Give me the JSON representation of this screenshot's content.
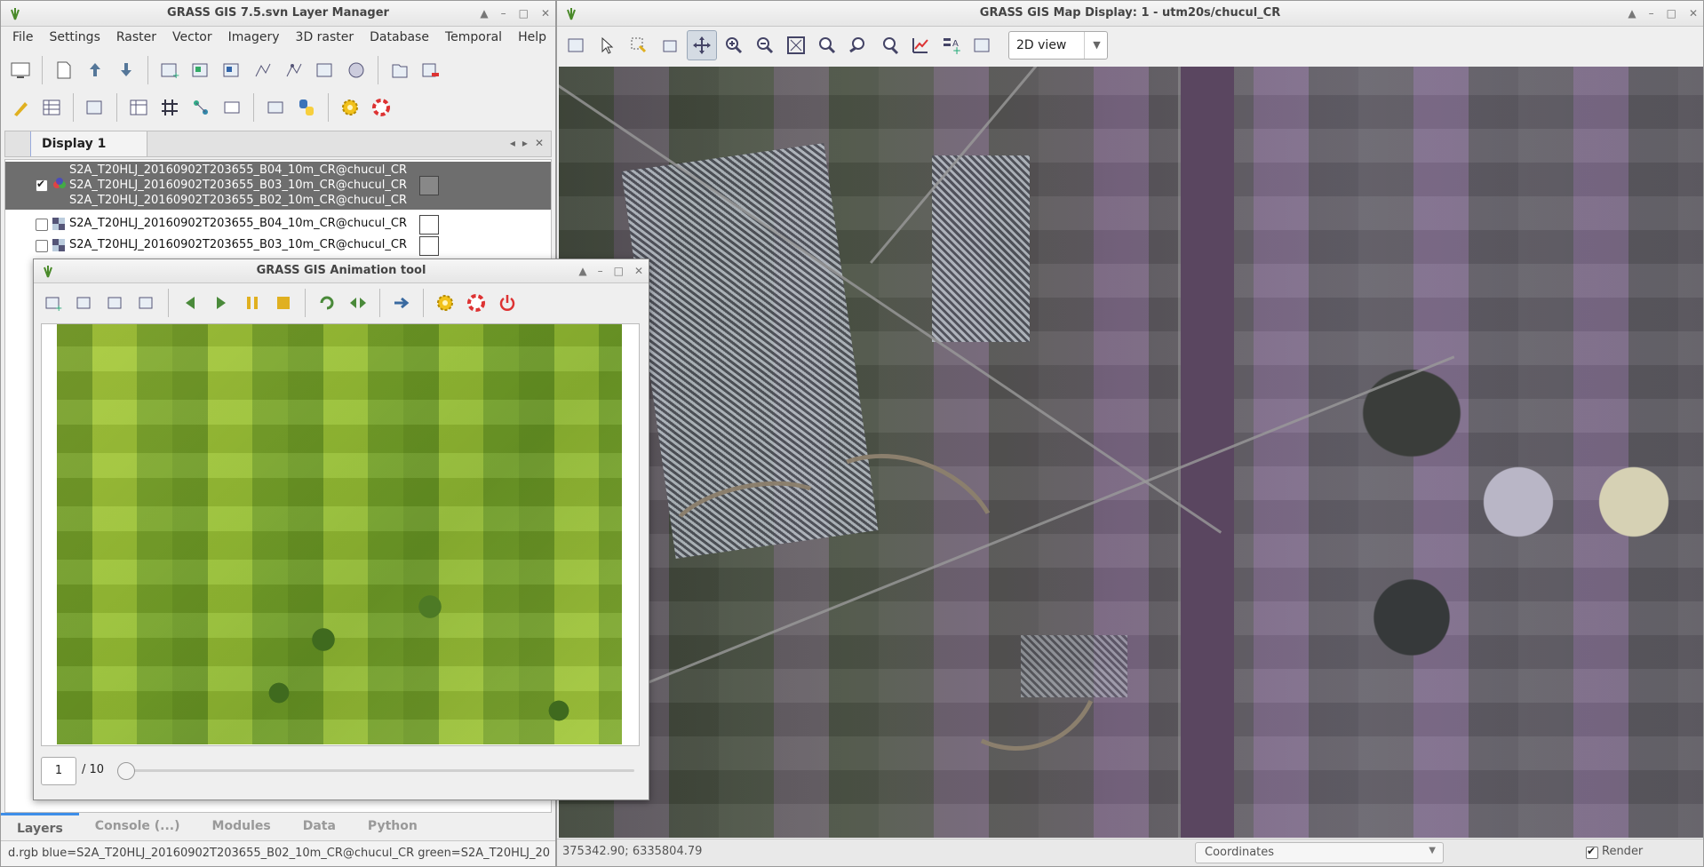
{
  "layer_manager": {
    "title": "GRASS GIS 7.5.svn Layer Manager",
    "menu": [
      "File",
      "Settings",
      "Raster",
      "Vector",
      "Imagery",
      "3D raster",
      "Database",
      "Temporal",
      "Help"
    ],
    "display_tab": "Display 1",
    "layers": [
      {
        "lines": [
          "S2A_T20HLJ_20160902T203655_B04_10m_CR@chucul_CR",
          "S2A_T20HLJ_20160902T203655_B03_10m_CR@chucul_CR",
          "S2A_T20HLJ_20160902T203655_B02_10m_CR@chucul_CR"
        ],
        "checked": true,
        "selected": true
      },
      {
        "label": "S2A_T20HLJ_20160902T203655_B04_10m_CR@chucul_CR",
        "checked": false
      },
      {
        "label": "S2A_T20HLJ_20160902T203655_B03_10m_CR@chucul_CR",
        "checked": false
      }
    ],
    "bottom_tabs": [
      "Layers",
      "Console (...)",
      "Modules",
      "Data",
      "Python"
    ],
    "command": "d.rgb blue=S2A_T20HLJ_20160902T203655_B02_10m_CR@chucul_CR green=S2A_T20HLJ_20"
  },
  "map_display": {
    "title": "GRASS GIS Map Display: 1 - utm20s/chucul_CR",
    "view_mode": "2D view",
    "coords": "375342.90; 6335804.79",
    "status_mode": "Coordinates",
    "render_label": "Render"
  },
  "animation_tool": {
    "title": "GRASS GIS Animation tool",
    "frame": "1",
    "frame_total": "/ 10",
    "progress": 0.0
  }
}
